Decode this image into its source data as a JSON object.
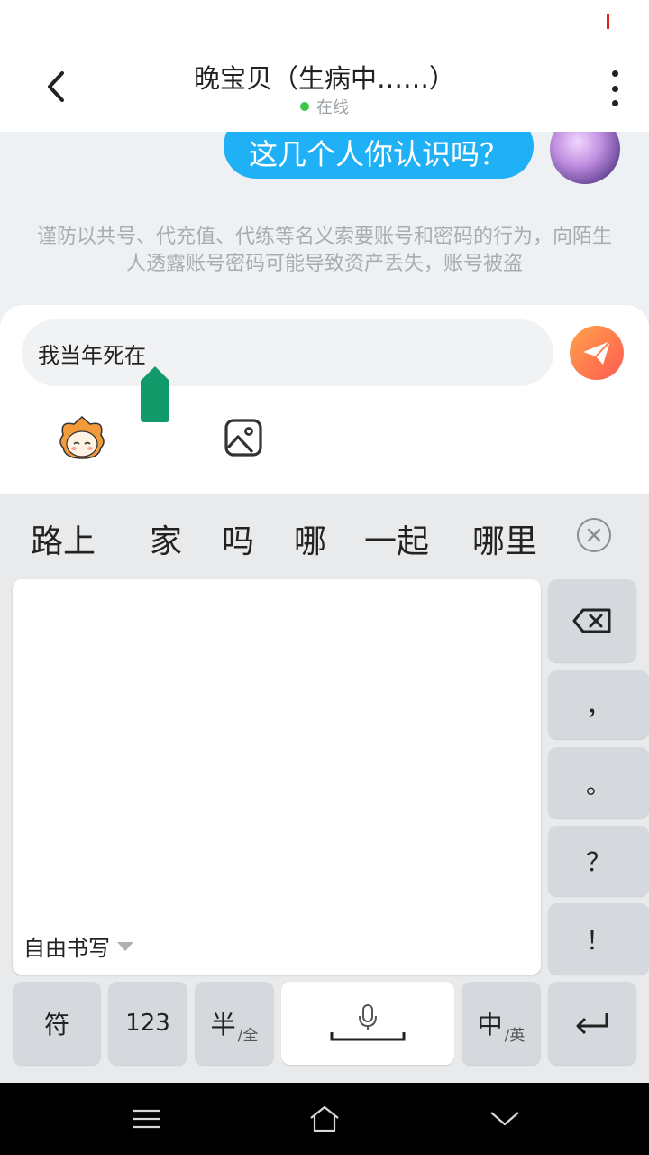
{
  "header": {
    "title": "晚宝贝（生病中……）",
    "status": "在线"
  },
  "chat": {
    "message": "这几个人你认识吗？",
    "warning": "谨防以共号、代充值、代练等名义索要账号和密码的行为，向陌生人透露账号密码可能导致资产丢失，账号被盗"
  },
  "input": {
    "value": "我当年死在"
  },
  "keyboard": {
    "candidates": [
      "路上",
      "家",
      "吗",
      "哪",
      "一起",
      "哪里"
    ],
    "handwriting_mode": "自由书写",
    "punctuation": [
      "，",
      "。",
      "？",
      "！"
    ],
    "keys": {
      "symbols": "符",
      "numbers": "123",
      "half_main": "半",
      "half_sub": "/全",
      "lang_main": "中",
      "lang_sub": "/英"
    }
  },
  "icons": {
    "back": "chevron-left-icon",
    "more": "more-vertical-icon",
    "send": "paper-plane-icon",
    "emoji": "emoji-icon",
    "image": "image-icon",
    "close_candidates": "close-circle-icon",
    "backspace": "backspace-icon",
    "mic": "microphone-icon",
    "enter": "enter-icon",
    "nav_menu": "menu-icon",
    "nav_home": "home-icon",
    "nav_back": "chevron-down-icon"
  },
  "colors": {
    "bubble": "#1fb0f5",
    "online": "#3ac84a",
    "send_start": "#ffa24a",
    "send_end": "#ff5a52",
    "cursor_handle": "#129a6a"
  }
}
